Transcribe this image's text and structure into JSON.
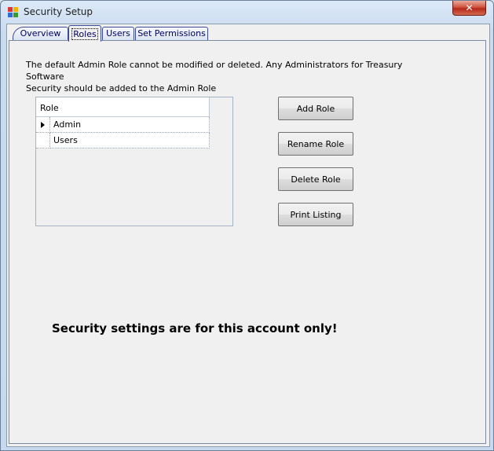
{
  "window": {
    "title": "Security Setup",
    "close_symbol": "✕",
    "icon": "app-icon"
  },
  "tabs": [
    {
      "label": "Overview",
      "active": false
    },
    {
      "label": "Roles",
      "active": true
    },
    {
      "label": "Users",
      "active": false
    },
    {
      "label": "Set Permissions",
      "active": false
    }
  ],
  "roles_page": {
    "info_line1": "The default Admin Role cannot be modified or deleted.  Any Administrators for Treasury Software",
    "info_line2": "Security should be added to the Admin Role",
    "grid": {
      "column_header": "Role",
      "rows": [
        {
          "value": "Admin",
          "selected": true
        },
        {
          "value": "Users",
          "selected": false
        }
      ]
    },
    "buttons": {
      "add": "Add Role",
      "rename": "Rename Role",
      "delete": "Delete Role",
      "print": "Print Listing"
    },
    "notice": "Security settings are for this account only!"
  }
}
